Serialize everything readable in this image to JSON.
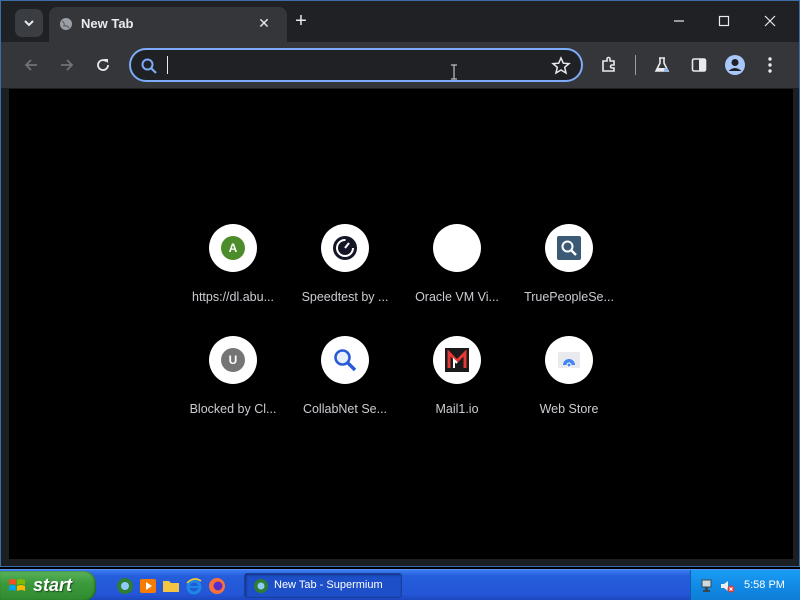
{
  "browser": {
    "tab": {
      "title": "New Tab"
    },
    "omnibox": {
      "value": "",
      "placeholder": ""
    }
  },
  "shortcuts": [
    {
      "label": "https://dl.abu...",
      "icon": "letter-a-badge",
      "letter": "A",
      "color": "#4c8c2b"
    },
    {
      "label": "Speedtest by ...",
      "icon": "speedometer-icon"
    },
    {
      "label": "Oracle VM Vi...",
      "icon": "blank-icon"
    },
    {
      "label": "TruePeopleSe...",
      "icon": "magnifier-square-icon"
    },
    {
      "label": "Blocked by Cl...",
      "icon": "letter-u-badge",
      "letter": "U",
      "color": "#757575"
    },
    {
      "label": "CollabNet Se...",
      "icon": "magnifier-icon"
    },
    {
      "label": "Mail1.io",
      "icon": "mail1-logo-icon"
    },
    {
      "label": "Web Store",
      "icon": "web-store-icon"
    }
  ],
  "taskbar": {
    "start_label": "start",
    "task_label": "New Tab - Supermium",
    "clock": "5:58 PM"
  },
  "colors": {
    "accent": "#7cacf8",
    "toolbar": "#35363a",
    "titlebar": "#1f2124"
  }
}
